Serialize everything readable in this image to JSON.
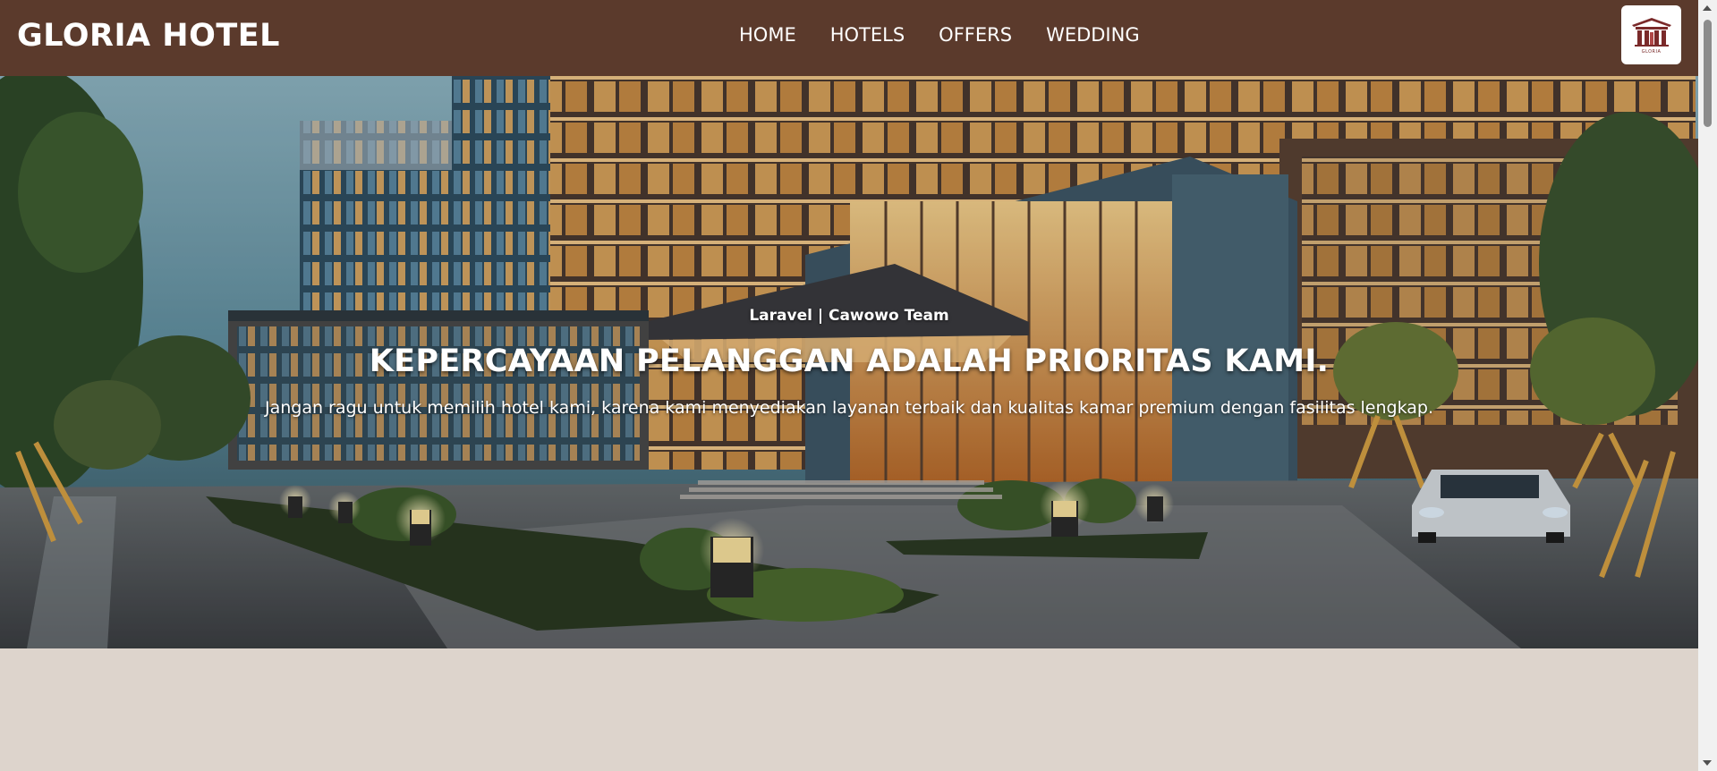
{
  "header": {
    "brand": "GLORIA HOTEL",
    "nav": [
      {
        "label": "HOME"
      },
      {
        "label": "HOTELS"
      },
      {
        "label": "OFFERS"
      },
      {
        "label": "WEDDING"
      }
    ],
    "logo_text": "GLORIA"
  },
  "hero": {
    "kicker": "Laravel | Cawowo Team",
    "title": "KEPERCAYAAN PELANGGAN ADALAH PRIORITAS KAMI.",
    "subtitle": "Jangan ragu untuk memilih hotel kami, karena kami menyediakan layanan terbaik dan kualitas kamar premium dengan fasilitas lengkap."
  },
  "colors": {
    "navbar": "#5b3a2c",
    "page_background": "#ddd4cc",
    "logo_accent": "#7a2a2a"
  }
}
